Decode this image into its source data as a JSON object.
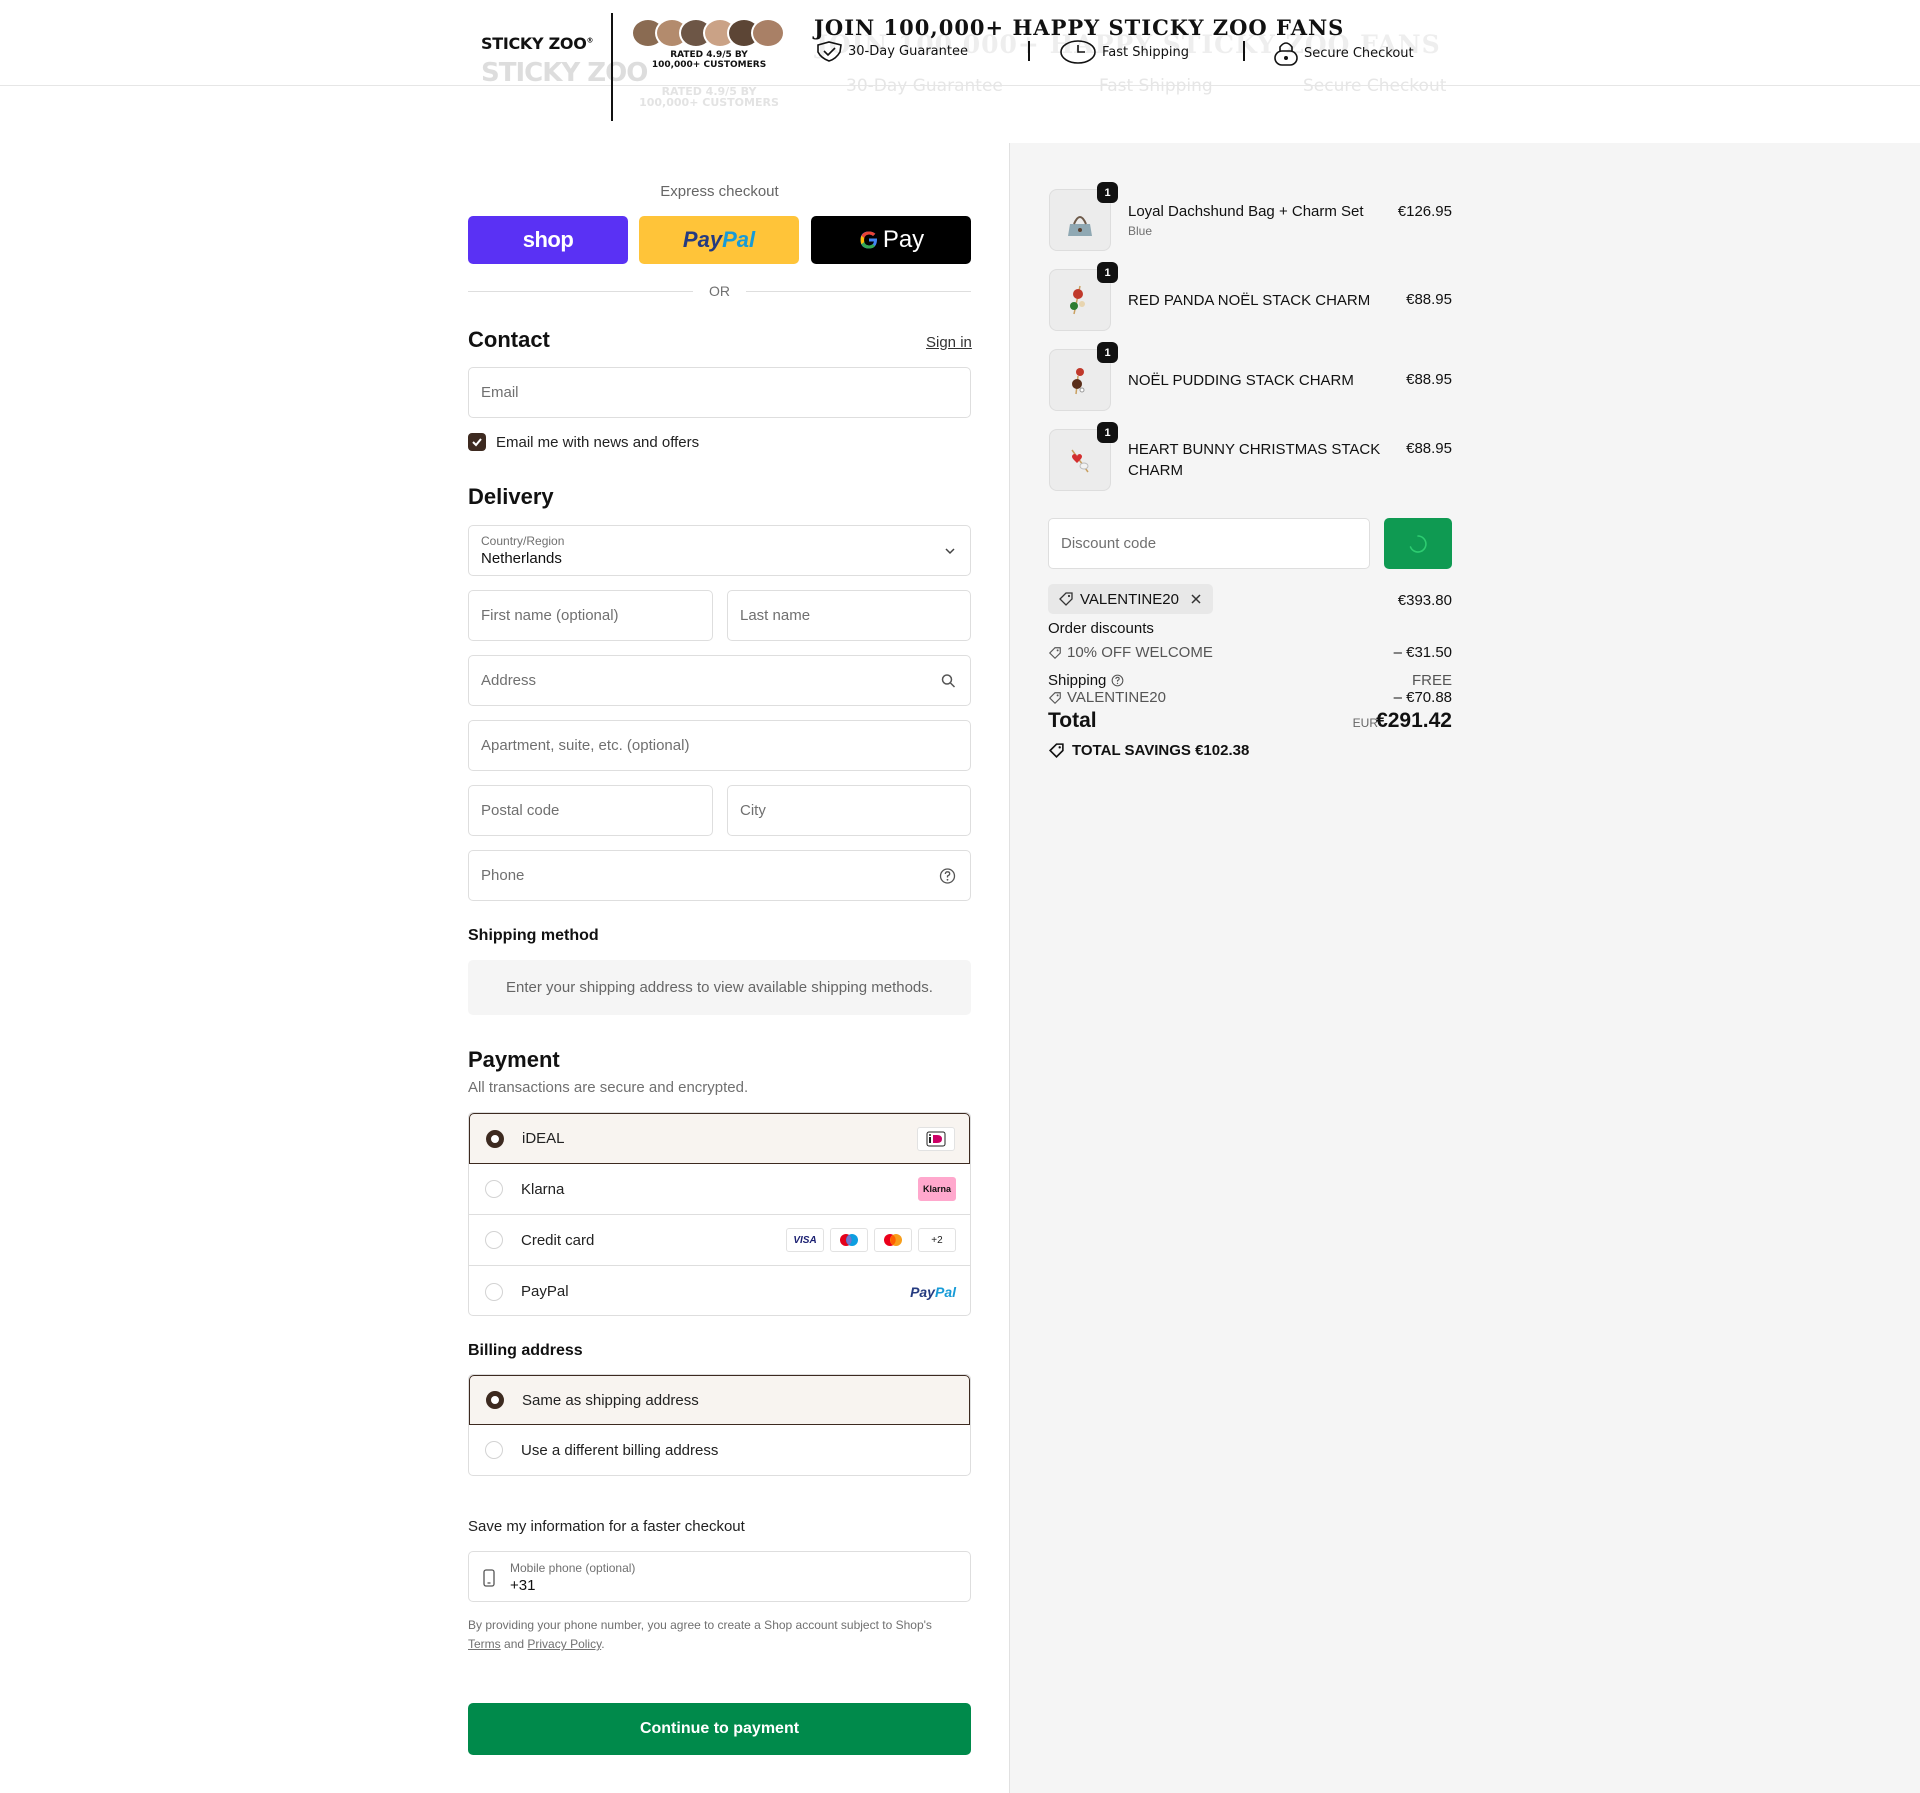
{
  "header": {
    "logo": "STICKY ZOO",
    "logo_mark": "®",
    "rated": "RATED 4.9/5 BY",
    "rated_line2": "100,000+ CUSTOMERS",
    "headline": "JOIN 100,000+ HAPPY STICKY ZOO FANS",
    "badges": {
      "guarantee": "30-Day Guarantee",
      "shipping": "Fast Shipping",
      "secure": "Secure Checkout"
    }
  },
  "express": {
    "label": "Express checkout",
    "shop": "shop",
    "paypal_pay": "Pay",
    "paypal_pal": "Pal",
    "gpay": "Pay",
    "or": "OR"
  },
  "contact": {
    "title": "Contact",
    "signin": "Sign in",
    "email_placeholder": "Email",
    "newsletter": "Email me with news and offers"
  },
  "delivery": {
    "title": "Delivery",
    "country_label": "Country/Region",
    "country_value": "Netherlands",
    "first_name": "First name (optional)",
    "last_name": "Last name",
    "address": "Address",
    "apartment": "Apartment, suite, etc. (optional)",
    "postal": "Postal code",
    "city": "City",
    "phone": "Phone"
  },
  "shipping_method": {
    "title": "Shipping method",
    "info": "Enter your shipping address to view available shipping methods."
  },
  "payment": {
    "title": "Payment",
    "subtitle": "All transactions are secure and encrypted.",
    "options": [
      {
        "label": "iDEAL"
      },
      {
        "label": "Klarna",
        "badge": "Klarna"
      },
      {
        "label": "Credit card",
        "visa": "VISA",
        "more": "+2"
      },
      {
        "label": "PayPal",
        "badge_pay": "Pay",
        "badge_pal": "Pal"
      }
    ]
  },
  "billing": {
    "title": "Billing address",
    "same": "Same as shipping address",
    "different": "Use a different billing address"
  },
  "save": {
    "label": "Save my information for a faster checkout",
    "phone_label": "Mobile phone (optional)",
    "phone_value": "+31",
    "legal_prefix": "By providing your phone number, you agree to create a Shop account subject to Shop's",
    "terms": "Terms",
    "and": "and",
    "privacy": "Privacy Policy",
    "legal_end": "."
  },
  "continue_button": "Continue to payment",
  "order": {
    "items": [
      {
        "qty": "1",
        "name": "Loyal Dachshund Bag + Charm Set",
        "variant": "Blue",
        "price": "€126.95"
      },
      {
        "qty": "1",
        "name": "RED PANDA NOËL STACK CHARM",
        "price": "€88.95"
      },
      {
        "qty": "1",
        "name": "NOËL PUDDING STACK CHARM",
        "price": "€88.95"
      },
      {
        "qty": "1",
        "name_line1": "HEART BUNNY CHRISTMAS STACK",
        "name_line2": "CHARM",
        "price": "€88.95"
      }
    ],
    "discount_placeholder": "Discount code",
    "applied_code": "VALENTINE20",
    "subtotal": "€393.80",
    "order_discounts_label": "Order discounts",
    "welcome_discount_label": "10% OFF WELCOME",
    "welcome_discount_value": "– €31.50",
    "shipping_label": "Shipping",
    "shipping_value": "FREE",
    "shipping_code": "VALENTINE20",
    "shipping_code_value": "– €70.88",
    "total_label": "Total",
    "currency": "EUR",
    "total": "€291.42",
    "savings_label": "TOTAL SAVINGS",
    "savings_value": "€102.38"
  },
  "colors": {
    "shop_purple": "#5a31f4",
    "paypal_yellow": "#ffc439",
    "brand_dark": "#3d2a20",
    "continue_green": "#008a4b",
    "apply_green": "#0f9a52"
  }
}
